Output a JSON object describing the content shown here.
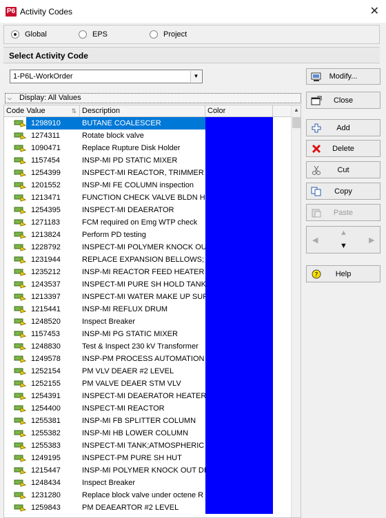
{
  "window": {
    "title": "Activity Codes",
    "app_badge": "P6"
  },
  "scope": {
    "options": [
      {
        "label": "Global",
        "checked": true
      },
      {
        "label": "EPS",
        "checked": false
      },
      {
        "label": "Project",
        "checked": false
      }
    ]
  },
  "select_section": {
    "heading": "Select Activity Code",
    "selected_value": "1-P6L-WorkOrder"
  },
  "buttons": {
    "modify": "Modify...",
    "close": "Close",
    "add": "Add",
    "delete": "Delete",
    "cut": "Cut",
    "copy": "Copy",
    "paste": "Paste",
    "help": "Help"
  },
  "display_bar": "Display: All Values",
  "grid": {
    "columns": [
      "Code Value",
      "Description",
      "Color"
    ],
    "color_value": "#0000ff",
    "selected_index": 0,
    "rows": [
      {
        "code": "1298910",
        "desc": "BUTANE COALESCER"
      },
      {
        "code": "1274311",
        "desc": "Rotate block valve"
      },
      {
        "code": "1090471",
        "desc": "Replace Rupture Disk Holder"
      },
      {
        "code": "1157454",
        "desc": "INSP-MI PD STATIC MIXER"
      },
      {
        "code": "1254399",
        "desc": "INSPECT-MI REACTOR, TRIMMER"
      },
      {
        "code": "1201552",
        "desc": "INSP-MI FE COLUMN inspection"
      },
      {
        "code": "1213471",
        "desc": "FUNCTION CHECK VALVE BLDN HEA"
      },
      {
        "code": "1254395",
        "desc": "INSPECT-MI DEAERATOR"
      },
      {
        "code": "1271183",
        "desc": "FCM required on Emg WTP check"
      },
      {
        "code": "1213824",
        "desc": "Perform PD testing"
      },
      {
        "code": "1228792",
        "desc": "INSPECT-MI POLYMER KNOCK OUT I"
      },
      {
        "code": "1231944",
        "desc": "REPLACE EXPANSION BELLOWS; V"
      },
      {
        "code": "1235212",
        "desc": "INSP-MI REACTOR FEED HEATER"
      },
      {
        "code": "1243537",
        "desc": "INSPECT-MI PURE SH HOLD TANK IN"
      },
      {
        "code": "1213397",
        "desc": "INSPECT-MI WATER MAKE UP SURG"
      },
      {
        "code": "1215441",
        "desc": "INSP-MI REFLUX DRUM"
      },
      {
        "code": "1248520",
        "desc": "Inspect Breaker"
      },
      {
        "code": "1157453",
        "desc": "INSP-MI PG STATIC MIXER"
      },
      {
        "code": "1248830",
        "desc": "Test & Inspect 230 kV Transformer"
      },
      {
        "code": "1249578",
        "desc": "INSP-PM PROCESS AUTOMATION NE"
      },
      {
        "code": "1252154",
        "desc": "PM VLV  DEAER #2 LEVEL"
      },
      {
        "code": "1252155",
        "desc": "PM VALVE DEAER STM VLV"
      },
      {
        "code": "1254391",
        "desc": "INSPECT-MI DEAERATOR HEATER"
      },
      {
        "code": "1254400",
        "desc": "INSPECT-MI REACTOR"
      },
      {
        "code": "1255381",
        "desc": "INSP-MI FB SPLITTER COLUMN"
      },
      {
        "code": "1255382",
        "desc": "INSP-MI HB LOWER COLUMN"
      },
      {
        "code": "1255383",
        "desc": "INSPECT-MI TANK;ATMOSPHERIC DT"
      },
      {
        "code": "1249195",
        "desc": "INSPECT-PM PURE SH HUT"
      },
      {
        "code": "1215447",
        "desc": "INSP-MI POLYMER KNOCK OUT DRU"
      },
      {
        "code": "1248434",
        "desc": "Inspect Breaker"
      },
      {
        "code": "1231280",
        "desc": "Replace block valve under octene R"
      },
      {
        "code": "1259843",
        "desc": "PM DEAEARTOR #2 LEVEL"
      }
    ]
  }
}
